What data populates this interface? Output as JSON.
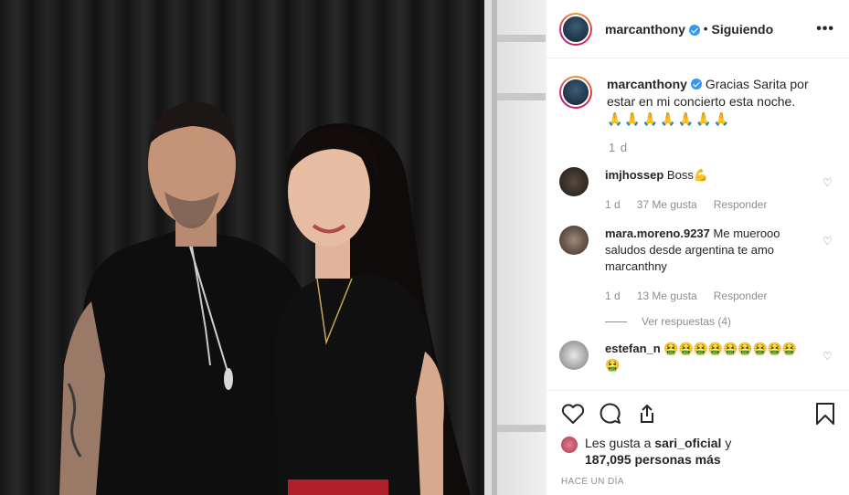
{
  "post": {
    "username": "marcanthony",
    "follow_status": "Siguiendo",
    "separator": "•",
    "more": "•••"
  },
  "caption": {
    "username": "marcanthony",
    "text": "Gracias Sarita por estar en mi concierto esta noche.",
    "emojis": "🙏🙏🙏🙏🙏🙏🙏",
    "time": "1 d"
  },
  "comments": [
    {
      "username": "imjhossep",
      "text": "Boss",
      "emoji": "💪",
      "time": "1 d",
      "likes": "37 Me gusta",
      "reply": "Responder"
    },
    {
      "username": "mara.moreno.9237",
      "text": "Me muerooo saludos desde argentina te amo marcanthny",
      "time": "1 d",
      "likes": "13 Me gusta",
      "reply": "Responder",
      "view_replies": "Ver respuestas (4)"
    },
    {
      "username": "estefan_n",
      "emoji": "🤮🤮🤮🤮🤮🤮🤮🤮🤮🤮"
    }
  ],
  "likes": {
    "prefix": "Les gusta a",
    "user": "sari_oficial",
    "connector": "y",
    "count": "187,095 personas más"
  },
  "timestamp": "HACE UN DÍA"
}
